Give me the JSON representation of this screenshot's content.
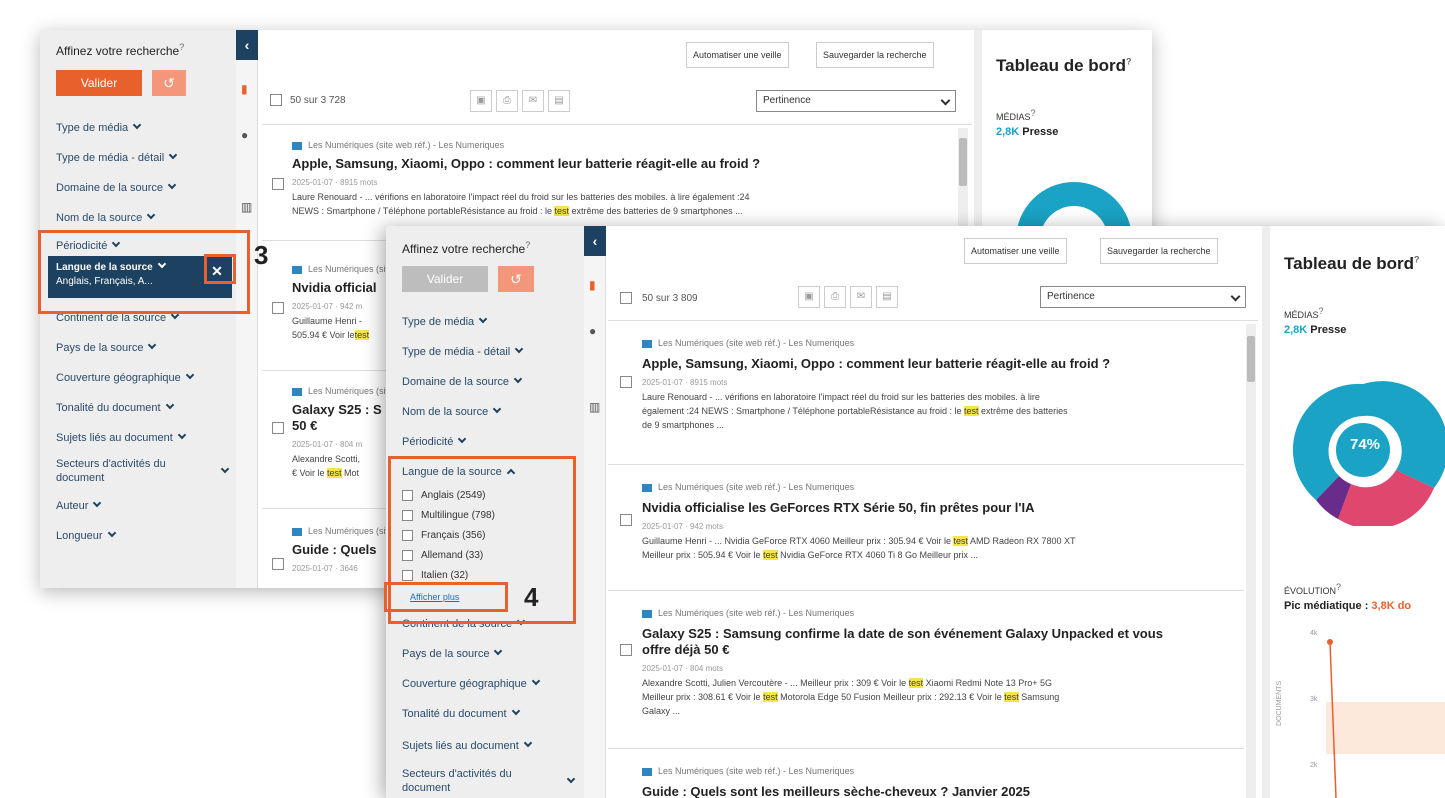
{
  "sidebar": {
    "title": "Affinez votre recherche",
    "valider": "Valider",
    "reset_icon": "↺",
    "filters1": [
      "Type de média",
      "Type de média - détail",
      "Domaine de la source",
      "Nom de la source",
      "Périodicité"
    ],
    "active": {
      "label": "Langue de la source",
      "value": "Anglais, Français, A..."
    },
    "filters1b": [
      "Continent de la source",
      "Pays de la source",
      "Couverture géographique",
      "Tonalité du document",
      "Sujets liés au document",
      "Secteurs d'activités du",
      "document",
      "Auteur",
      "Longueur"
    ],
    "filters2": [
      "Type de média",
      "Type de média - détail",
      "Domaine de la source",
      "Nom de la source",
      "Périodicité"
    ],
    "lang_label": "Langue de la source",
    "langs": [
      "Anglais (2549)",
      "Multilingue (798)",
      "Français (356)",
      "Allemand (33)",
      "Italien (32)"
    ],
    "show_more": "Afficher plus",
    "filters2b": [
      "Continent de la source",
      "Pays de la source",
      "Couverture géographique",
      "Tonalité du document",
      "Sujets liés au document",
      "Secteurs d'activités du",
      "document"
    ]
  },
  "callouts": {
    "c3": "3",
    "c4": "4"
  },
  "toolbar": {
    "automate": "Automatiser une veille",
    "save": "Sauvegarder la recherche",
    "count1": "50 sur 3 728",
    "count2": "50 sur 3 809",
    "sort": "Pertinence"
  },
  "articles": [
    {
      "src": "Les Numériques (site web réf.) - Les Numeriques",
      "title": "Apple, Samsung, Xiaomi, Oppo : comment leur batterie réagit-elle au froid ?",
      "meta": "2025-01-07 · 8915 mots",
      "s1a": "Laure Renouard - ... vérifions en laboratoire l'impact réel du froid sur les batteries des mobiles. à lire",
      "s1b": "également :24 NEWS : Smartphone / Téléphone portableRésistance au froid : le ",
      "s1hl": "test",
      "s1c": " extrême des batteries",
      "s1d": "de 9 smartphones ...",
      "w1a": "Laure Renouard - ... vérifions en laboratoire l'impact réel du froid sur les batteries des mobiles. à lire également :24",
      "w1b": "NEWS : Smartphone / Téléphone portableRésistance au froid : le ",
      "w1c": " extrême des batteries de 9 smartphones ..."
    },
    {
      "src": "Les Numériques (site web réf.) - Les Numeriques",
      "title": "Nvidia officialise les GeForces RTX Série 50, fin prêtes pour l'IA",
      "meta": "2025-01-07 · 942 mots",
      "s1": "Guillaume Henri - ... Nvidia GeForce RTX 4060 Meilleur prix : 305.94 € Voir le ",
      "s2": " AMD Radeon RX 7800 XT",
      "s3": "Meilleur prix : 505.94 € Voir le ",
      "s4": " Nvidia GeForce RTX 4060 Ti 8 Go Meilleur prix ...",
      "w1title": "Nvidia official",
      "w1meta": "2025-01-07 · 942 m",
      "w1s1": "Guillaume Henri -",
      "w1s2": "505.94 € Voir le"
    },
    {
      "src": "Les Numériques (site web réf.) - Les Numeriques",
      "title": "Galaxy S25 : Samsung confirme la date de son événement Galaxy Unpacked et vous",
      "title2": "offre déjà 50 €",
      "meta": "2025-01-07 · 804 mots",
      "s1": "Alexandre Scotti, Julien Vercoutère - ... Meilleur prix : 309 € Voir le ",
      "s2": " Xiaomi Redmi Note 13 Pro+ 5G",
      "s3": "Meilleur prix : 308.61 € Voir le ",
      "s4": " Motorola Edge 50 Fusion Meilleur prix : 292.13 € Voir le ",
      "s5": " Samsung",
      "s6": "Galaxy ...",
      "w1title": "Galaxy S25 : S",
      "w1title2": "50 €",
      "w1meta": "2025-01-07 · 804 m",
      "w1s1": "Alexandre Scotti,",
      "w1s2": "€ Voir le ",
      "w1s3": " Mot"
    },
    {
      "src": "Les Numériques (site web réf.) - Les Numeriques",
      "title": "Guide : Quels sont les meilleurs sèche-cheveux ? Janvier 2025",
      "w1title": "Guide : Quels",
      "w1meta": "2025-01-07 · 3646"
    }
  ],
  "hl": "test",
  "dashboard": {
    "title": "Tableau de bord",
    "medias": "MÉDIAS",
    "num": "2,8K",
    "presse": " Presse",
    "pct": "74%",
    "evolution": "ÉVOLUTION",
    "pic": "Pic médiatique : ",
    "pic_val": "3,8K do",
    "docs": "DOCUMENTS",
    "y4k": "4k",
    "y3k": "3k",
    "y2k": "2k"
  },
  "colors": {
    "accent": "#e8602b",
    "navy": "#1d4160",
    "teal": "#1aa3c4",
    "pink": "#e0476e",
    "purple": "#6a2c8a"
  }
}
